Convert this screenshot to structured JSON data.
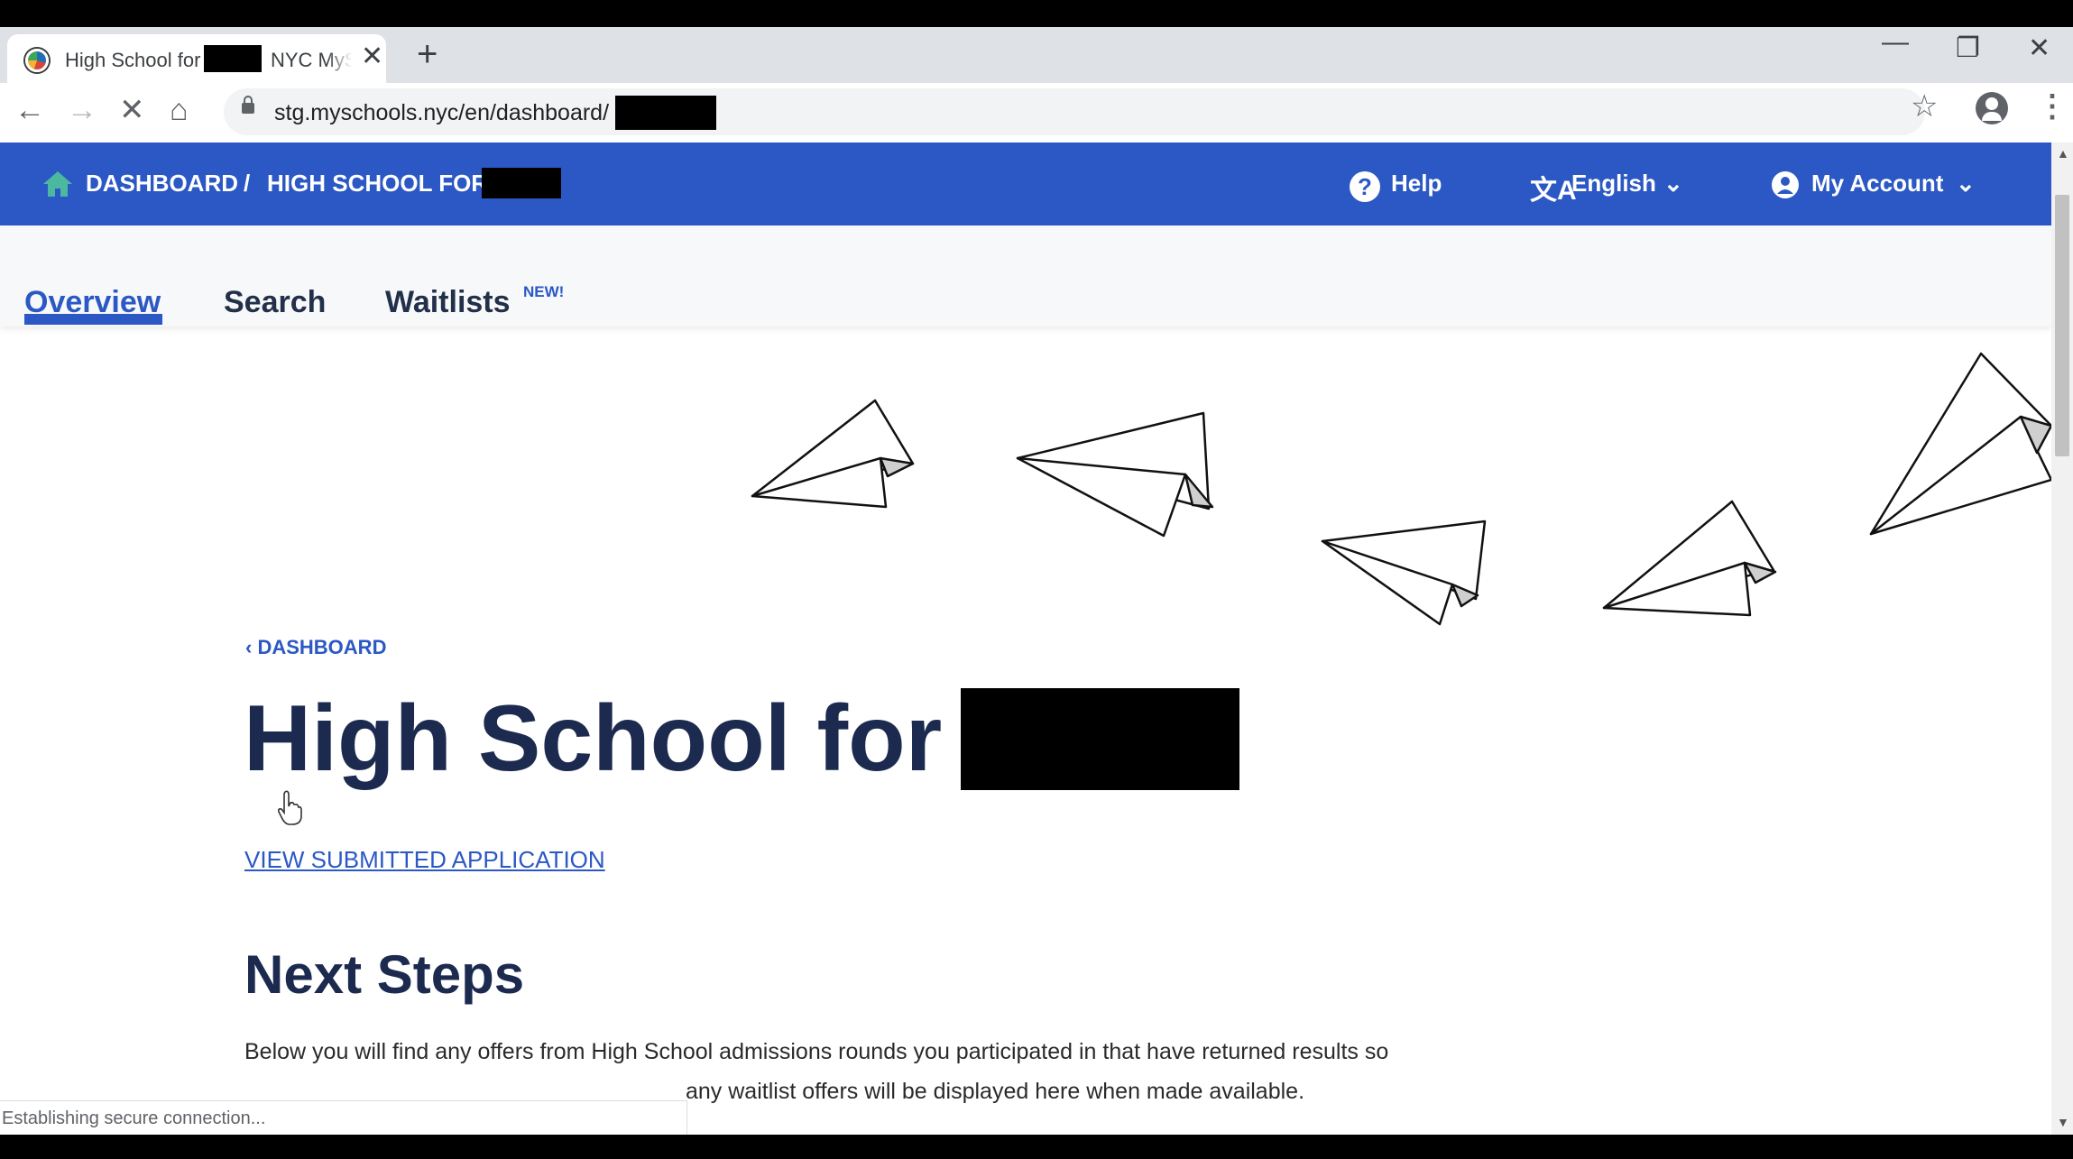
{
  "browser": {
    "tab_title_part1": "High School for",
    "tab_title_part2": "NYC MySchools",
    "tab_close": "✕",
    "new_tab": "+",
    "url": "stg.myschools.nyc/en/dashboard/",
    "status_text": "Establishing secure connection..."
  },
  "header": {
    "breadcrumb_home": "DASHBOARD",
    "breadcrumb_sep": "/",
    "breadcrumb_current": "HIGH SCHOOL FOR",
    "help_label": "Help",
    "language_label": "English",
    "account_label": "My Account"
  },
  "subnav": {
    "tabs": [
      {
        "label": "Overview",
        "active": true
      },
      {
        "label": "Search"
      },
      {
        "label": "Waitlists"
      }
    ],
    "new_badge": "NEW!"
  },
  "main": {
    "back_link": "DASHBOARD",
    "page_title": "High School for",
    "view_application": "VIEW SUBMITTED APPLICATION",
    "next_steps_heading": "Next Steps",
    "body_line1": "Below you will find any offers from High School admissions rounds you participated in that have returned results so",
    "body_line2": "any waitlist offers will be displayed here when made available."
  },
  "colors": {
    "accent": "#2b58c4",
    "heading": "#1b2a4e"
  }
}
